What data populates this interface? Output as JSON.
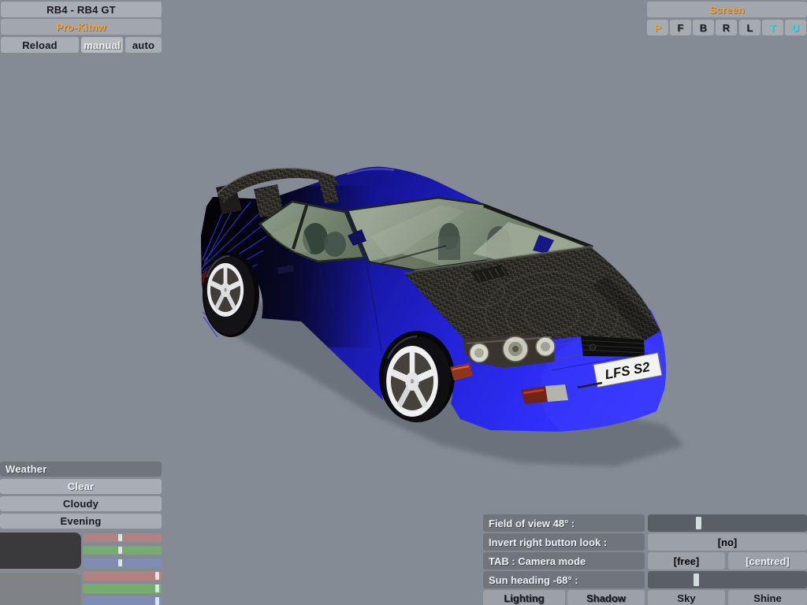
{
  "app": {
    "background_color": "#848b94",
    "accent_orange": "#f0a238",
    "accent_cyan": "#18e6e6"
  },
  "header": {
    "car_title": "RB4 - RB4 GT",
    "skin_name": "Pro-Kitnw",
    "reload_label": "Reload",
    "manual_label": "manual",
    "auto_label": "auto"
  },
  "screen_panel": {
    "title": "Screen",
    "buttons": [
      {
        "label": "P",
        "color": "#f0a238"
      },
      {
        "label": "F",
        "color": "#17191c"
      },
      {
        "label": "B",
        "color": "#17191c"
      },
      {
        "label": "R",
        "color": "#17191c"
      },
      {
        "label": "L",
        "color": "#17191c"
      },
      {
        "label": "T",
        "color": "#18e6e6"
      },
      {
        "label": "U",
        "color": "#18e6e6"
      }
    ]
  },
  "viewport": {
    "license_plate": "LFS S2",
    "car_body_color": "#2525dd"
  },
  "weather_panel": {
    "title": "Weather",
    "selected": "Clear",
    "options": [
      {
        "label": "Clear"
      },
      {
        "label": "Cloudy"
      },
      {
        "label": "Evening"
      }
    ]
  },
  "color_mixers": {
    "groups": [
      {
        "swatch_color": "#3a3a3c",
        "channels": [
          {
            "name": "red",
            "color": "#b28181",
            "handle_left": "47%"
          },
          {
            "name": "green",
            "color": "#76ac6e",
            "handle_left": "47%"
          },
          {
            "name": "blue",
            "color": "#7e8db8",
            "handle_left": "47%"
          }
        ]
      },
      {
        "swatch_color": "#7f8286",
        "channels": [
          {
            "name": "red",
            "color": "#b28181",
            "handle_left": "94%"
          },
          {
            "name": "green",
            "color": "#76ac6e",
            "handle_left": "94%"
          },
          {
            "name": "blue",
            "color": "#7e8db8",
            "handle_left": "94%"
          }
        ]
      }
    ]
  },
  "settings_panel": {
    "rows": [
      {
        "label": "Field of view 48° :",
        "type": "slider",
        "handle_left": "31.5%"
      },
      {
        "label": "Invert right button look :",
        "type": "value",
        "value": "[no]"
      },
      {
        "label": "TAB : Camera mode",
        "type": "buttons",
        "options": [
          "[free]",
          "[centred]"
        ],
        "selected": "[centred]"
      },
      {
        "label": "Sun heading -68° :",
        "type": "slider",
        "handle_left": "30%"
      }
    ],
    "footer_buttons": [
      {
        "label": "Lighting",
        "active": true
      },
      {
        "label": "Shadow",
        "active": true
      },
      {
        "label": "Sky",
        "active": false
      },
      {
        "label": "Shine",
        "active": false
      }
    ]
  }
}
